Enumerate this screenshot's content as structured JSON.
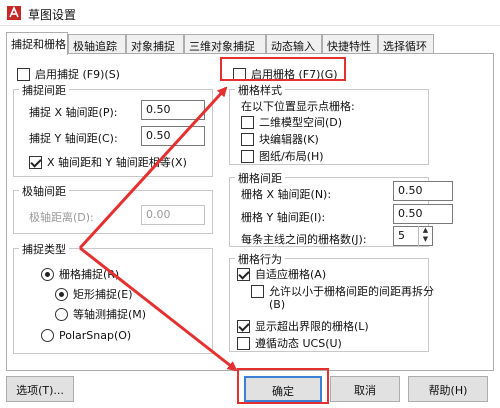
{
  "window": {
    "title": "草图设置"
  },
  "tabs": [
    {
      "label": "捕捉和栅格",
      "active": true
    },
    {
      "label": "极轴追踪"
    },
    {
      "label": "对象捕捉"
    },
    {
      "label": "三维对象捕捉"
    },
    {
      "label": "动态输入"
    },
    {
      "label": "快捷特性"
    },
    {
      "label": "选择循环"
    }
  ],
  "snap": {
    "enable_label": "启用捕捉 (F9)(S)",
    "enable_checked": false,
    "spacing": {
      "title": "捕捉间距",
      "x_label": "捕捉 X 轴间距(P):",
      "x_value": "0.50",
      "y_label": "捕捉 Y 轴间距(C):",
      "y_value": "0.50",
      "equal_label": "X 轴间距和 Y 轴间距相等(X)",
      "equal_checked": true
    },
    "polar": {
      "title": "极轴间距",
      "distance_label": "极轴距离(D):",
      "distance_value": "0.00"
    },
    "type": {
      "title": "捕捉类型",
      "grid_snap": "栅格捕捉(R)",
      "rect_snap": "矩形捕捉(E)",
      "iso_snap": "等轴测捕捉(M)",
      "polar_snap": "PolarSnap(O)",
      "selected": "grid_snap",
      "sub_selected": "rect_snap"
    }
  },
  "grid": {
    "enable_label": "启用栅格 (F7)(G)",
    "enable_checked": false,
    "style": {
      "title": "栅格样式",
      "caption": "在以下位置显示点栅格:",
      "model_space": "二维模型空间(D)",
      "block_editor": "块编辑器(K)",
      "sheet_layout": "图纸/布局(H)"
    },
    "spacing": {
      "title": "栅格间距",
      "x_label": "栅格 X 轴间距(N):",
      "x_value": "0.50",
      "y_label": "栅格 Y 轴间距(I):",
      "y_value": "0.50",
      "major_label": "每条主线之间的栅格数(J):",
      "major_value": "5"
    },
    "behavior": {
      "title": "栅格行为",
      "adaptive": "自适应栅格(A)",
      "adaptive_checked": true,
      "subdivide": "允许以小于栅格间距的间距再拆分",
      "subdivide_key": "(B)",
      "subdivide_checked": false,
      "beyond_limits": "显示超出界限的栅格(L)",
      "beyond_checked": true,
      "follow_ucs": "遵循动态 UCS(U)",
      "follow_checked": false
    }
  },
  "buttons": {
    "options": "选项(T)...",
    "ok": "确定",
    "cancel": "取消",
    "help": "帮助(H)"
  },
  "colors": {
    "annotation_red": "#e53030",
    "default_button_border": "#3c7fd5"
  }
}
